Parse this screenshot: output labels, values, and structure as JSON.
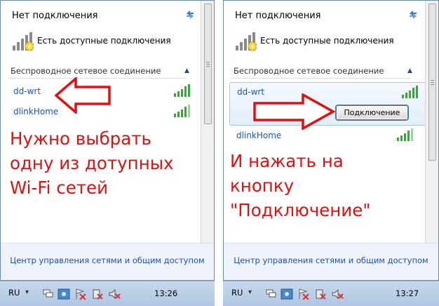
{
  "left": {
    "status": "Нет подключения",
    "available": "Есть доступные подключения",
    "section": "Беспроводное сетевое соединение",
    "networks": [
      {
        "name": "dd-wrt"
      },
      {
        "name": "dlinkHome"
      }
    ],
    "annotation": [
      "Нужно выбрать",
      "одну из дотупных",
      "Wi-Fi сетей"
    ],
    "footer_link": "Центр управления сетями и общим доступом",
    "taskbar": {
      "lang": "RU",
      "clock": "13:26"
    }
  },
  "right": {
    "status": "Нет подключения",
    "available": "Есть доступные подключения",
    "section": "Беспроводное сетевое соединение",
    "networks": [
      {
        "name": "dd-wrt",
        "selected": true
      },
      {
        "name": "dlinkHome"
      }
    ],
    "connect_label": "Подключение",
    "annotation": [
      "И нажать на",
      "кнопку",
      "\"Подключение\""
    ],
    "footer_link": "Центр управления сетями и общим доступом",
    "taskbar": {
      "lang": "RU",
      "clock": "13:27"
    }
  },
  "icons": {
    "refresh": "refresh-icon",
    "available": "network-available-icon",
    "signal": "wifi-signal-icon",
    "chevron": "chevron-up-icon",
    "arrow": "red-arrow-icon",
    "tray": [
      "flag-icon",
      "network-tray-icon",
      "action-center-icon",
      "power-icon",
      "volume-icon"
    ]
  },
  "colors": {
    "link": "#1a55c2",
    "annotation": "#e01010",
    "signal": "#3aa63a",
    "taskbar": "#b9cde6"
  }
}
